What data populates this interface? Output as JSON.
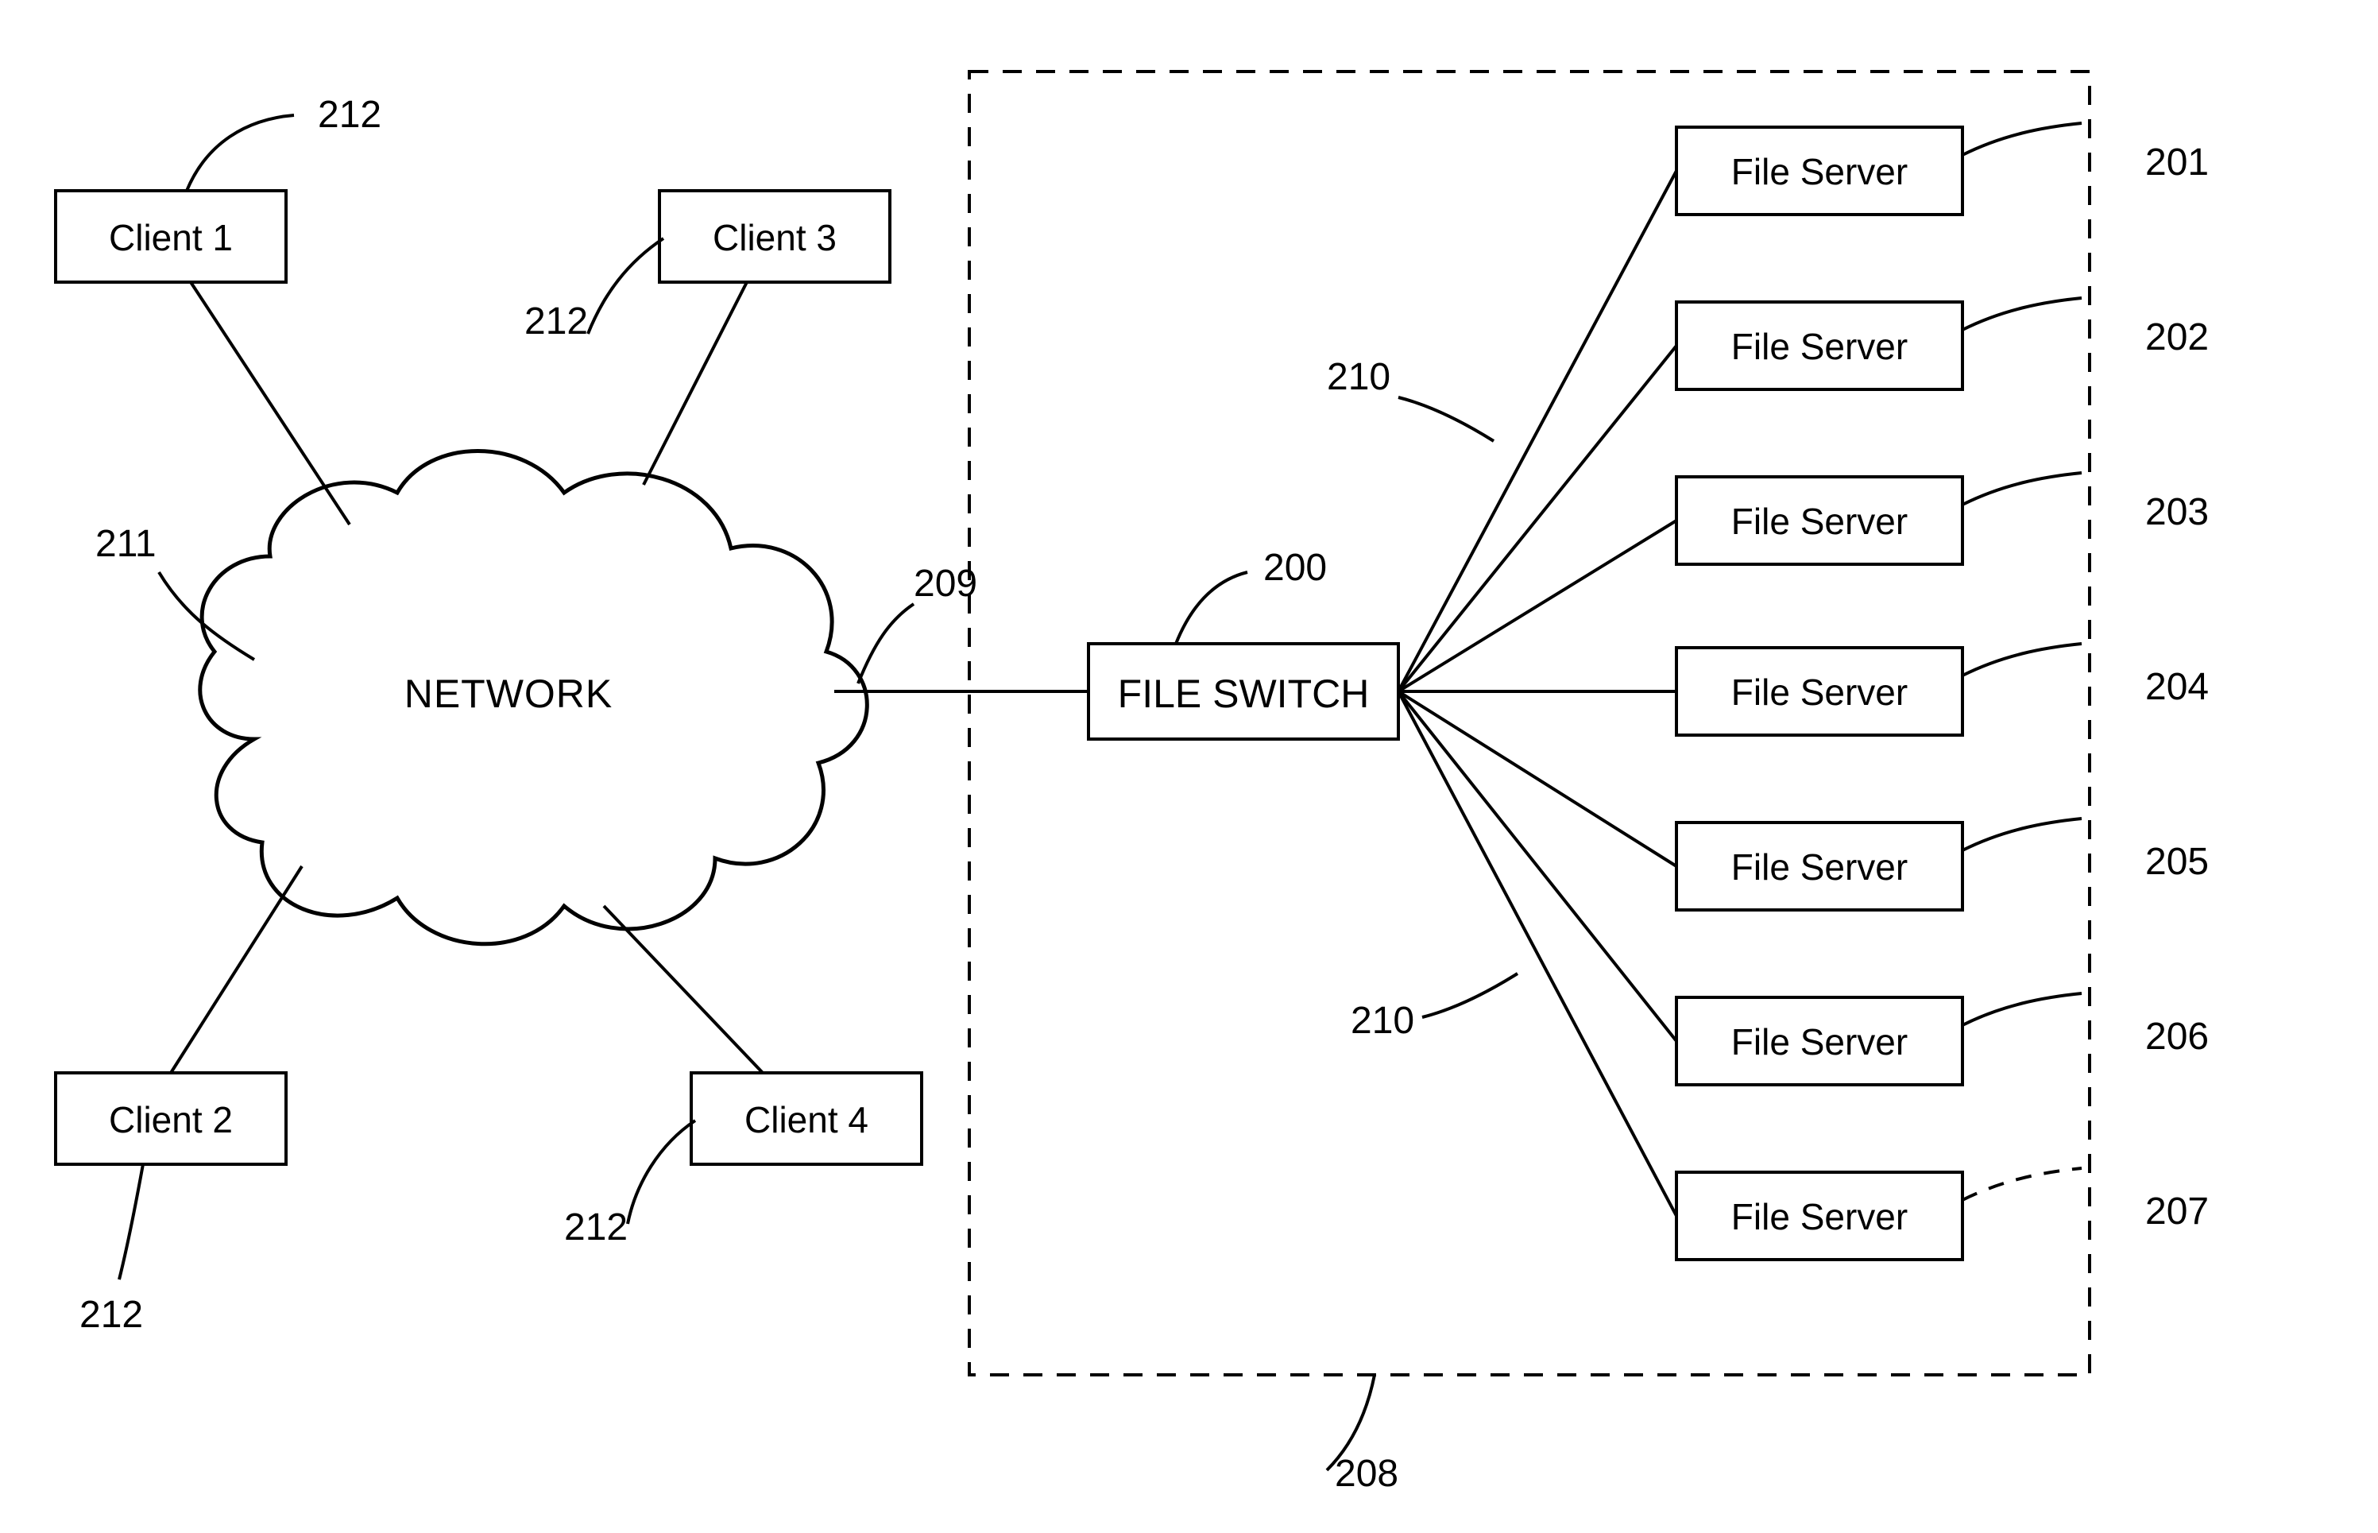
{
  "network": {
    "label": "NETWORK"
  },
  "clients": [
    {
      "label": "Client 1"
    },
    {
      "label": "Client 2"
    },
    {
      "label": "Client 3"
    },
    {
      "label": "Client 4"
    }
  ],
  "switch": {
    "label": "FILE SWITCH"
  },
  "servers": [
    {
      "label": "File Server"
    },
    {
      "label": "File Server"
    },
    {
      "label": "File Server"
    },
    {
      "label": "File Server"
    },
    {
      "label": "File Server"
    },
    {
      "label": "File Server"
    },
    {
      "label": "File Server"
    }
  ],
  "refs": {
    "r200": "200",
    "r201": "201",
    "r202": "202",
    "r203": "203",
    "r204": "204",
    "r205": "205",
    "r206": "206",
    "r207": "207",
    "r208": "208",
    "r209": "209",
    "r210a": "210",
    "r210b": "210",
    "r211": "211",
    "r212a": "212",
    "r212b": "212",
    "r212c": "212",
    "r212d": "212"
  }
}
